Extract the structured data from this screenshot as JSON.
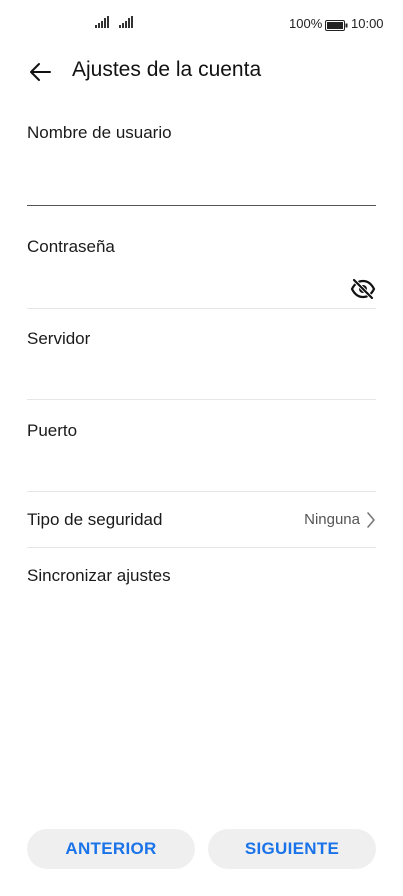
{
  "status_bar": {
    "battery_percent": "100%",
    "time": "10:00",
    "icons": [
      "signal-icon",
      "signal-icon",
      "battery-icon"
    ]
  },
  "header": {
    "title": "Ajustes de la cuenta",
    "back_icon": "arrow-left-icon"
  },
  "form": {
    "username_label": "Nombre de usuario",
    "username_value": "",
    "password_label": "Contraseña",
    "password_value": "",
    "password_toggle_icon": "eye-off-icon",
    "server_label": "Servidor",
    "server_value": "",
    "port_label": "Puerto",
    "port_value": "",
    "security_label": "Tipo de seguridad",
    "security_value": "Ninguna",
    "sync_label": "Sincronizar ajustes"
  },
  "footer": {
    "prev_label": "ANTERIOR",
    "next_label": "SIGUIENTE"
  },
  "colors": {
    "accent": "#1a73e8",
    "button_bg": "#efefef",
    "divider": "#e6e6e6",
    "active_underline": "#555555"
  }
}
